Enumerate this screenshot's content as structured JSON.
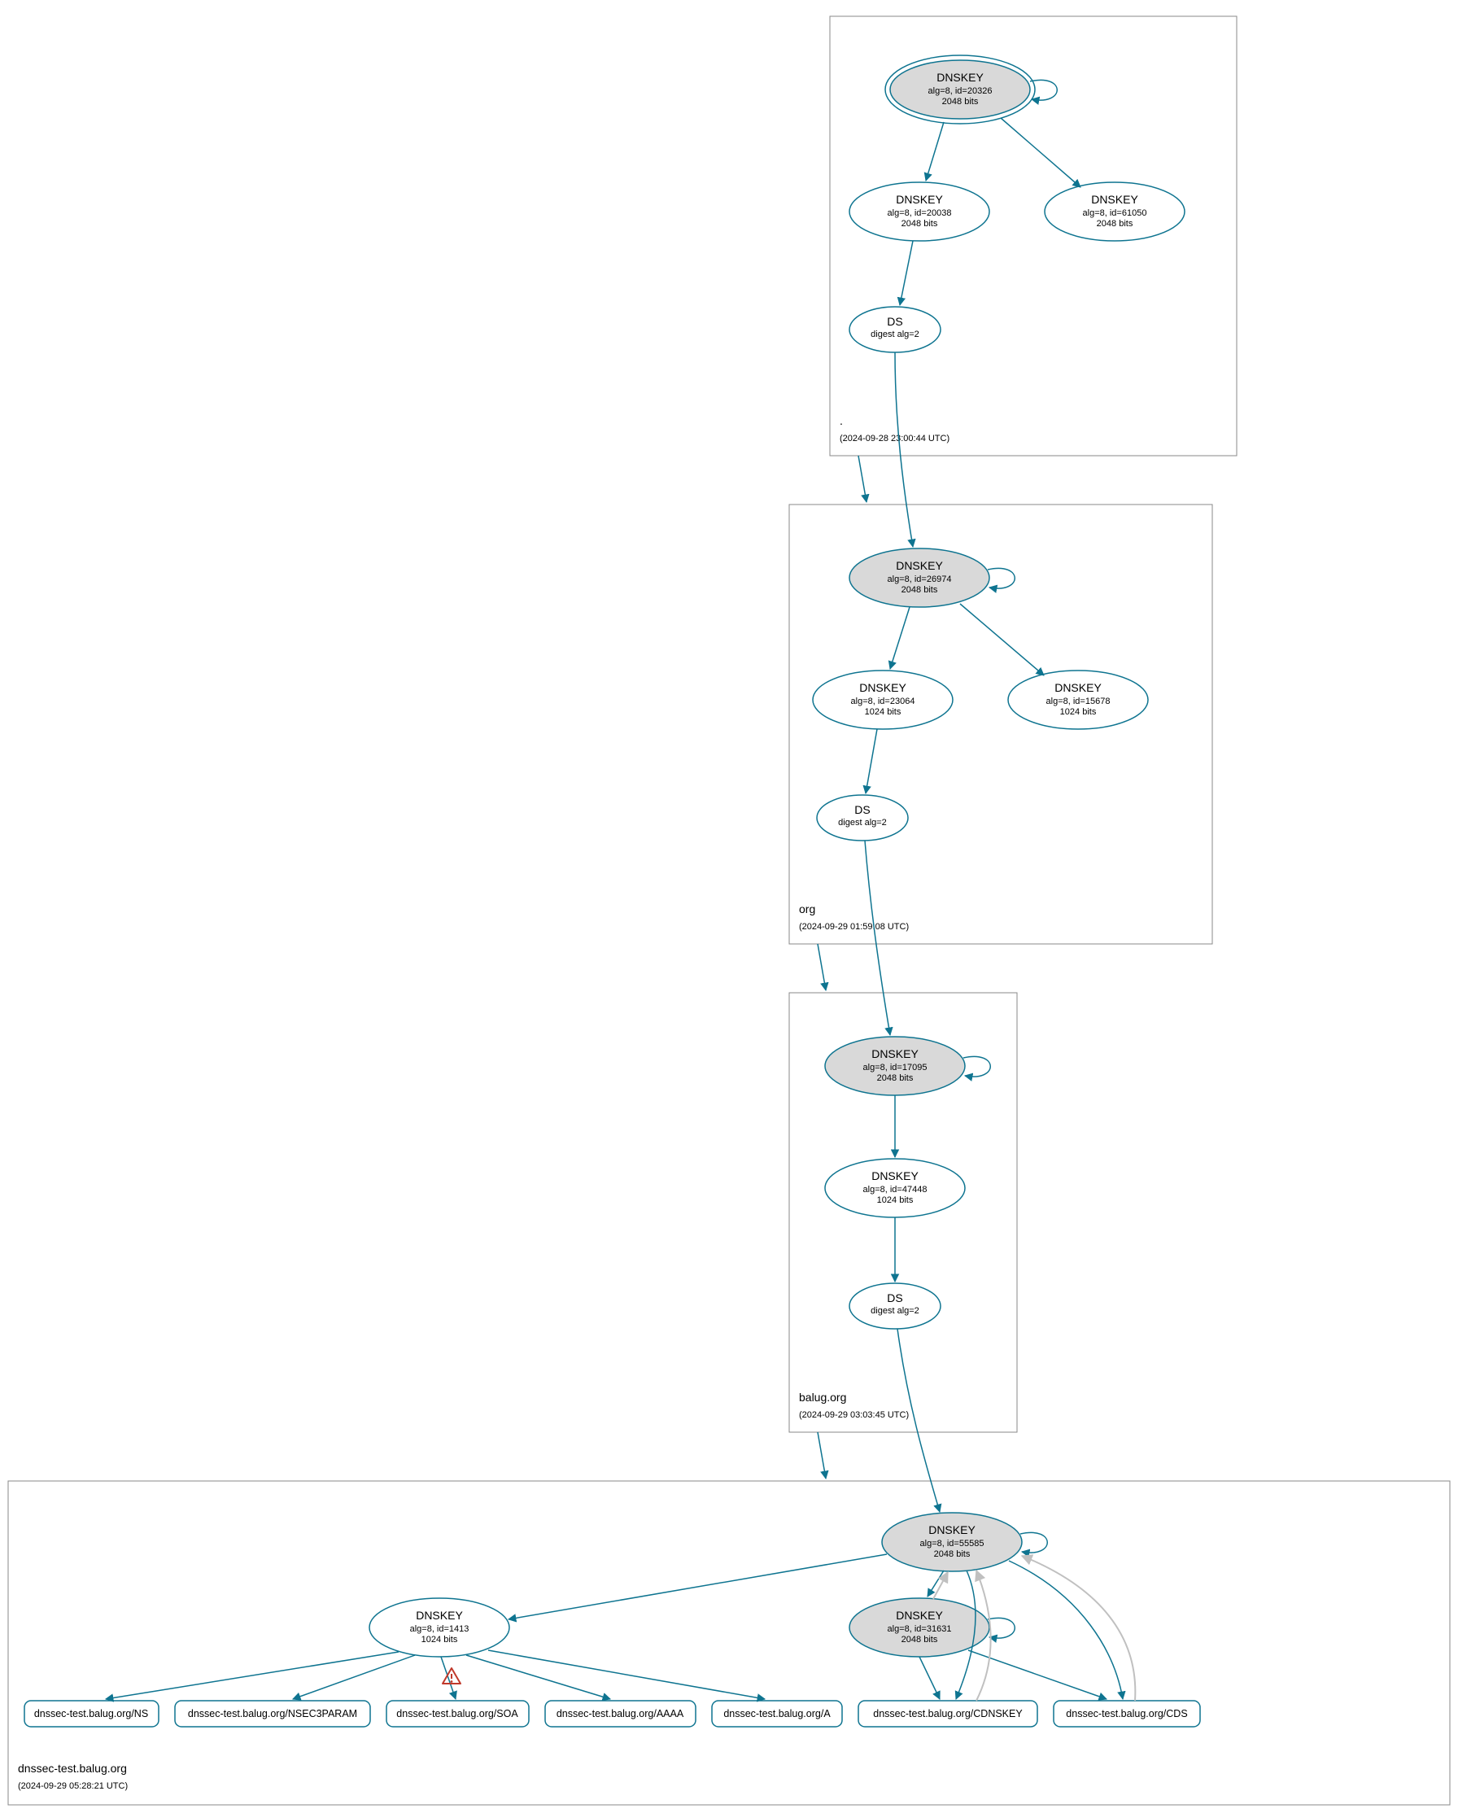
{
  "colors": {
    "accent": "#0e7490",
    "box": "#888888",
    "gray_edge": "#c0c0c0",
    "warn": "#c0392b",
    "ksk_fill": "#d9d9d9"
  },
  "zones": {
    "root": {
      "name": ".",
      "timestamp": "(2024-09-28 23:00:44 UTC)"
    },
    "org": {
      "name": "org",
      "timestamp": "(2024-09-29 01:59:08 UTC)"
    },
    "balug": {
      "name": "balug.org",
      "timestamp": "(2024-09-29 03:03:45 UTC)"
    },
    "dnssec": {
      "name": "dnssec-test.balug.org",
      "timestamp": "(2024-09-29 05:28:21 UTC)"
    }
  },
  "nodes": {
    "root_ksk": {
      "title": "DNSKEY",
      "line2": "alg=8, id=20326",
      "line3": "2048 bits"
    },
    "root_zsk1": {
      "title": "DNSKEY",
      "line2": "alg=8, id=20038",
      "line3": "2048 bits"
    },
    "root_zsk2": {
      "title": "DNSKEY",
      "line2": "alg=8, id=61050",
      "line3": "2048 bits"
    },
    "root_ds": {
      "title": "DS",
      "line2": "digest alg=2"
    },
    "org_ksk": {
      "title": "DNSKEY",
      "line2": "alg=8, id=26974",
      "line3": "2048 bits"
    },
    "org_zsk1": {
      "title": "DNSKEY",
      "line2": "alg=8, id=23064",
      "line3": "1024 bits"
    },
    "org_zsk2": {
      "title": "DNSKEY",
      "line2": "alg=8, id=15678",
      "line3": "1024 bits"
    },
    "org_ds": {
      "title": "DS",
      "line2": "digest alg=2"
    },
    "balug_ksk": {
      "title": "DNSKEY",
      "line2": "alg=8, id=17095",
      "line3": "2048 bits"
    },
    "balug_zsk": {
      "title": "DNSKEY",
      "line2": "alg=8, id=47448",
      "line3": "1024 bits"
    },
    "balug_ds": {
      "title": "DS",
      "line2": "digest alg=2"
    },
    "dnssec_ksk": {
      "title": "DNSKEY",
      "line2": "alg=8, id=55585",
      "line3": "2048 bits"
    },
    "dnssec_zsk": {
      "title": "DNSKEY",
      "line2": "alg=8, id=1413",
      "line3": "1024 bits"
    },
    "dnssec_ksk2": {
      "title": "DNSKEY",
      "line2": "alg=8, id=31631",
      "line3": "2048 bits"
    }
  },
  "rr": {
    "ns": "dnssec-test.balug.org/NS",
    "nsec3": "dnssec-test.balug.org/NSEC3PARAM",
    "soa": "dnssec-test.balug.org/SOA",
    "aaaa": "dnssec-test.balug.org/AAAA",
    "a": "dnssec-test.balug.org/A",
    "cdnskey": "dnssec-test.balug.org/CDNSKEY",
    "cds": "dnssec-test.balug.org/CDS"
  }
}
